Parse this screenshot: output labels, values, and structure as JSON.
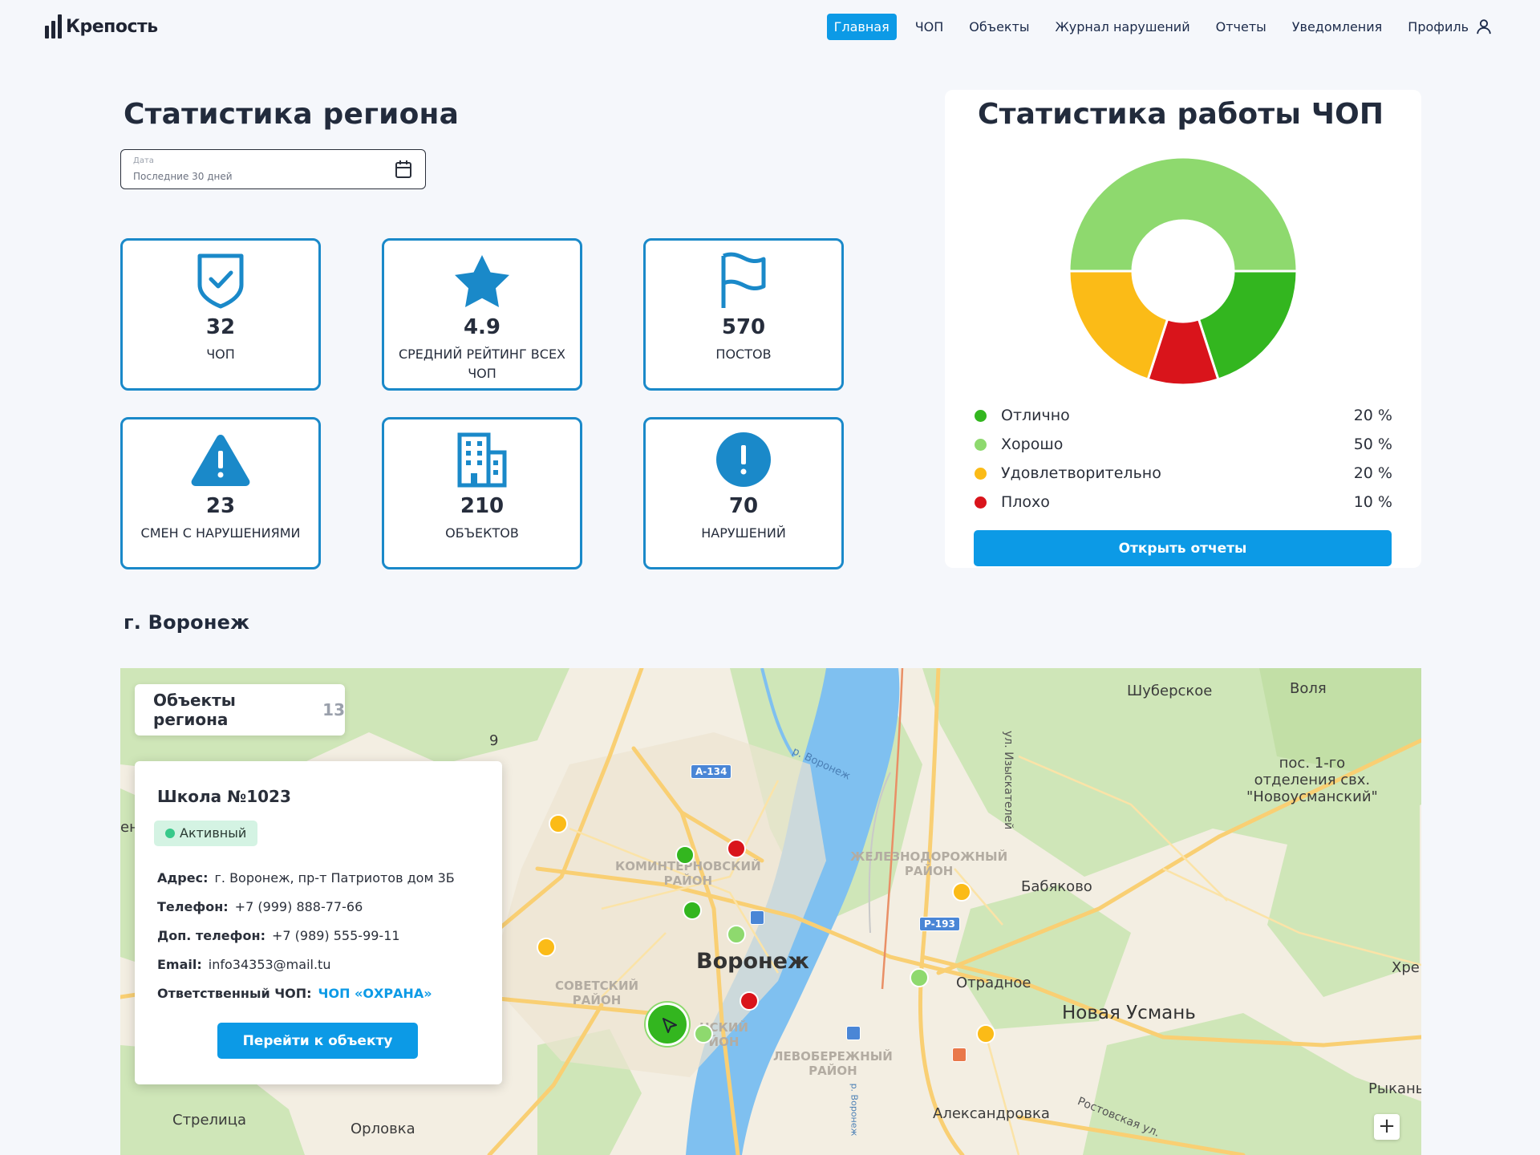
{
  "brand": {
    "name": "Крепость"
  },
  "nav": {
    "items": [
      "Главная",
      "ЧОП",
      "Объекты",
      "Журнал нарушений",
      "Отчеты",
      "Уведомления"
    ],
    "profile": "Профиль"
  },
  "region": {
    "title": "Статистика региона",
    "date_label": "Дата",
    "date_value": "Последние 30 дней"
  },
  "stats": [
    {
      "icon": "shield-check-icon",
      "value": "32",
      "caption": "ЧОП"
    },
    {
      "icon": "star-icon",
      "value": "4.9",
      "caption": "Средний рейтинг всех ЧОП"
    },
    {
      "icon": "flag-icon",
      "value": "570",
      "caption": "Постов"
    },
    {
      "icon": "warning-triangle-icon",
      "value": "23",
      "caption": "Смен с нарушениями"
    },
    {
      "icon": "building-icon",
      "value": "210",
      "caption": "Объектов"
    },
    {
      "icon": "exclamation-circle-icon",
      "value": "70",
      "caption": "Нарушений"
    }
  ],
  "chop_stats": {
    "title": "Статистика работы ЧОП",
    "open_reports": "Открыть отчеты",
    "chart_data": {
      "type": "pie",
      "categories": [
        "Отлично",
        "Хорошо",
        "Удовлетворительно",
        "Плохо"
      ],
      "values": [
        20,
        50,
        20,
        10
      ],
      "value_labels": [
        "20 %",
        "50 %",
        "20 %",
        "10 %"
      ],
      "colors": [
        "#33b61f",
        "#8ed96e",
        "#fbbb17",
        "#d9141b"
      ],
      "legend": "bottom"
    }
  },
  "map": {
    "city_title": "г. Воронеж",
    "objects_label": "Объекты региона",
    "objects_count": "13",
    "labels": {
      "shuberskoe": "Шуберское",
      "volya": "Воля",
      "pos": "пос. 1-го",
      "pos2": "отделения свх.",
      "pos3": "\"Новоусманский\"",
      "babyakovo": "Бабяково",
      "otradnoe": "Отрадное",
      "novaya_usman": "Новая Усмань",
      "voronezh": "Воронеж",
      "aleksandrovka": "Александровка",
      "strelitsa": "Стрелица",
      "orlovka": "Орловка",
      "khre": "Хре",
      "rykan": "Рыкань",
      "en": "ен",
      "nine": "9",
      "komintern1": "КОМИНТЕРНОВСКИЙ",
      "komintern2": "РАЙОН",
      "zhd1": "ЖЕЛЕЗНОДОРОЖНЫЙ",
      "zhd2": "РАЙОН",
      "sov1": "СОВЕТСКИЙ",
      "sov2": "РАЙОН",
      "len1": "НСКИЙ",
      "len2": "ЙОН",
      "lev1": "ЛЕВОБЕРЕЖНЫЙ",
      "lev2": "РАЙОН",
      "river": "р. Воронеж",
      "river2": "р. Воронеж",
      "street1": "ул. Изыскателей",
      "street2": "Ростовская ул.",
      "road_a134": "А-134",
      "road_r193": "Р-193"
    },
    "popup": {
      "title": "Школа №1023",
      "status": "Активный",
      "address_label": "Адрес:",
      "address": "г. Воронеж, пр-т Патриотов дом 3Б",
      "phone_label": "Телефон:",
      "phone": "+7 (999) 888-77-66",
      "phone2_label": "Доп. телефон:",
      "phone2": "+7 (989) 555-99-11",
      "email_label": "Email:",
      "email": "info34353@mail.tu",
      "chop_label": "Ответственный ЧОП:",
      "chop": "ЧОП «ОХРАНА»",
      "go_button": "Перейти к объекту"
    },
    "zoom_in": "+"
  }
}
